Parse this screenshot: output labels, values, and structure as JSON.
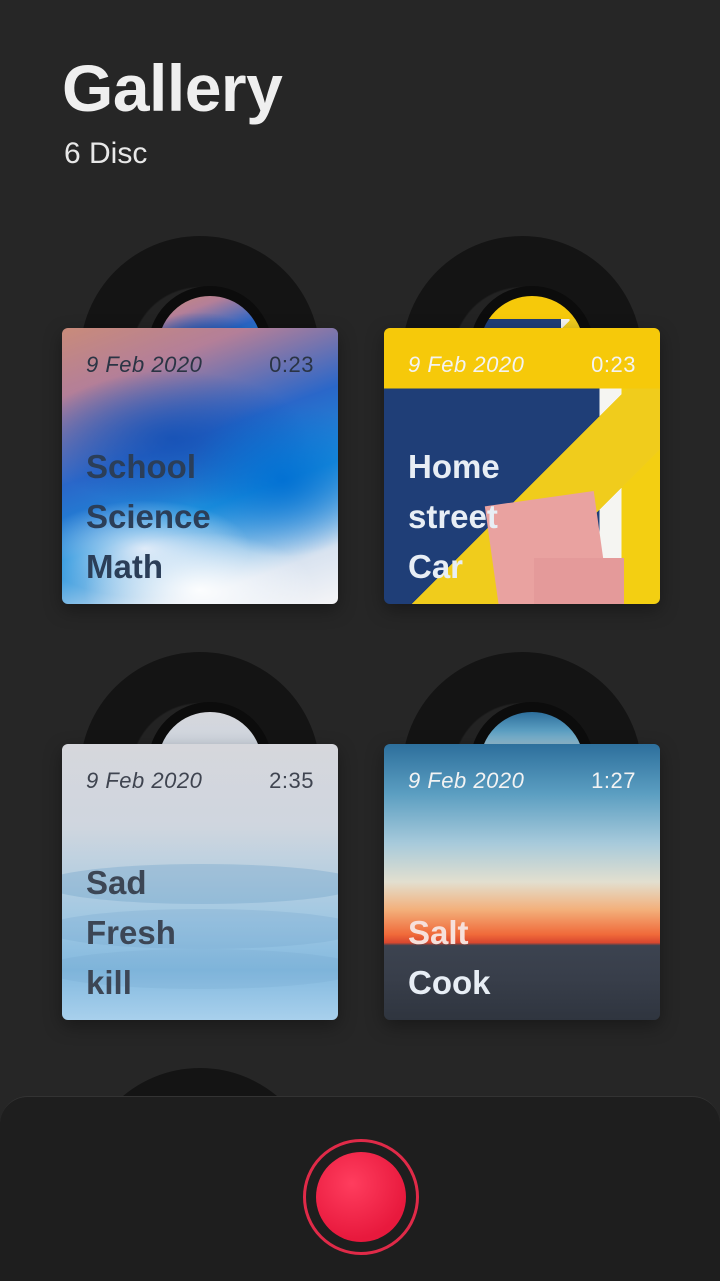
{
  "header": {
    "title": "Gallery",
    "subtitle": "6 Disc"
  },
  "albums": [
    {
      "date": "9 Feb 2020",
      "duration": "0:23",
      "tags": [
        "School",
        "Science",
        "Math"
      ],
      "art": "ocean"
    },
    {
      "date": "9 Feb 2020",
      "duration": "0:23",
      "tags": [
        "Home",
        "street",
        "Car"
      ],
      "art": "wall"
    },
    {
      "date": "9 Feb 2020",
      "duration": "2:35",
      "tags": [
        "Sad",
        "Fresh",
        "kill"
      ],
      "art": "mist"
    },
    {
      "date": "9 Feb 2020",
      "duration": "1:27",
      "tags": [
        "Salt",
        "Cook"
      ],
      "art": "sunset"
    }
  ],
  "colors": {
    "background": "#262626",
    "record_accent": "#e8193d"
  },
  "icons": {
    "record": "record-icon"
  }
}
